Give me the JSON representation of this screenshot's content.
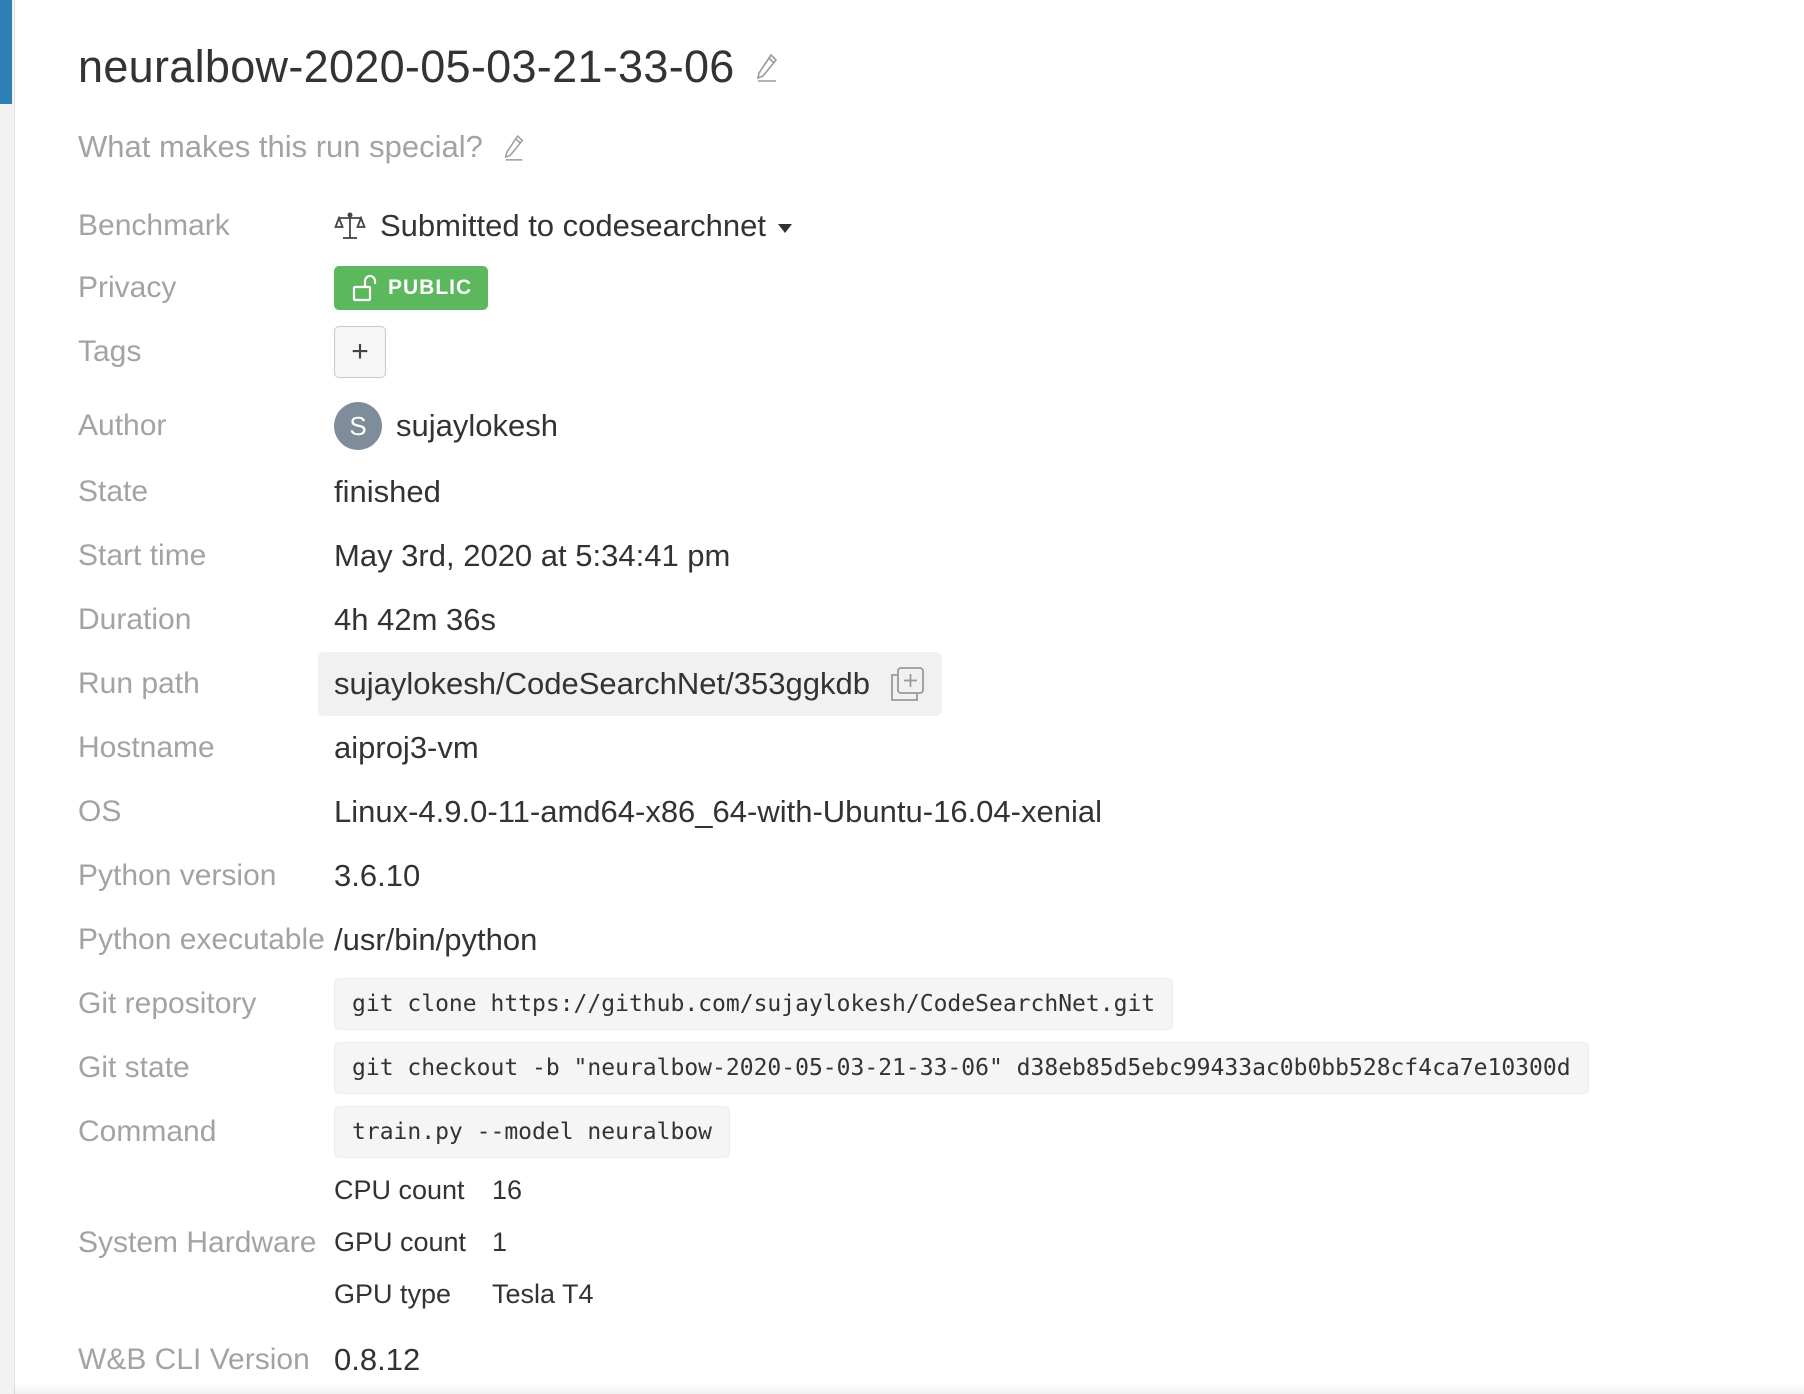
{
  "run": {
    "title": "neuralbow-2020-05-03-21-33-06",
    "description_placeholder": "What makes this run special?"
  },
  "fields": {
    "benchmark": {
      "label": "Benchmark",
      "value": "Submitted to codesearchnet",
      "icon": "scale-icon"
    },
    "privacy": {
      "label": "Privacy",
      "value": "PUBLIC",
      "color": "#5cb85c",
      "icon": "unlock-icon"
    },
    "tags": {
      "label": "Tags",
      "add_label": "+"
    },
    "author": {
      "label": "Author",
      "avatar_initial": "S",
      "value": "sujaylokesh",
      "avatar_color": "#7f8d9b"
    },
    "state": {
      "label": "State",
      "value": "finished"
    },
    "start_time": {
      "label": "Start time",
      "value": "May 3rd, 2020 at 5:34:41 pm"
    },
    "duration": {
      "label": "Duration",
      "value": "4h 42m 36s"
    },
    "run_path": {
      "label": "Run path",
      "value": "sujaylokesh/CodeSearchNet/353ggkdb",
      "icon": "copy-icon"
    },
    "hostname": {
      "label": "Hostname",
      "value": "aiproj3-vm"
    },
    "os": {
      "label": "OS",
      "value": "Linux-4.9.0-11-amd64-x86_64-with-Ubuntu-16.04-xenial"
    },
    "python_version": {
      "label": "Python version",
      "value": "3.6.10"
    },
    "python_executable": {
      "label": "Python executable",
      "value": "/usr/bin/python"
    },
    "git_repository": {
      "label": "Git repository",
      "value": "git clone https://github.com/sujaylokesh/CodeSearchNet.git"
    },
    "git_state": {
      "label": "Git state",
      "value": "git checkout -b \"neuralbow-2020-05-03-21-33-06\" d38eb85d5ebc99433ac0b0bb528cf4ca7e10300d"
    },
    "command": {
      "label": "Command",
      "value": "train.py --model neuralbow"
    },
    "system_hardware": {
      "label": "System Hardware",
      "rows": [
        {
          "key": "CPU count",
          "value": "16"
        },
        {
          "key": "GPU count",
          "value": "1"
        },
        {
          "key": "GPU type",
          "value": "Tesla T4"
        }
      ]
    },
    "cli_version": {
      "label": "W&B CLI Version",
      "value": "0.8.12"
    }
  },
  "colors": {
    "accent": "#2e7fb5",
    "label_gray": "#a3a3a3",
    "text": "#333333"
  }
}
